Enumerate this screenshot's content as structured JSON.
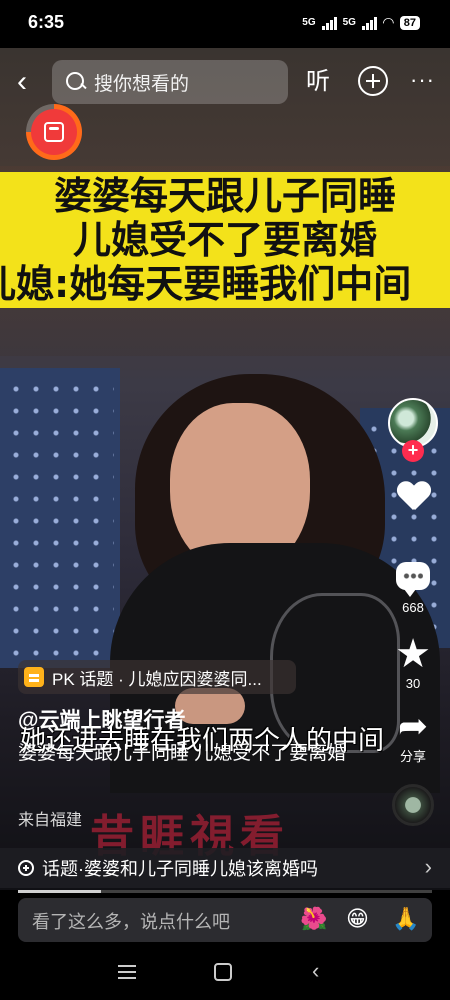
{
  "status_bar": {
    "time": "6:35",
    "network1": "5G",
    "network2": "5G",
    "battery": "87"
  },
  "top_nav": {
    "search_placeholder": "搜你想看的",
    "listen_label": "听"
  },
  "video": {
    "banner_lines": [
      "婆婆每天跟儿子同睡",
      "儿媳受不了要离婚",
      "儿媳:她每天要睡我们中间"
    ],
    "subtitle": "她还进去睡在我们两个人的中间",
    "watermark": "昔睚視看"
  },
  "rail": {
    "comment_count": "668",
    "favorite_count": "30",
    "share_label": "分享"
  },
  "post": {
    "topic_chip": "PK 话题 · 儿媳应因婆婆同...",
    "author": "@云端上眺望行者",
    "description": "婆婆每天跟儿子同睡 儿媳受不了要离婚",
    "location": "来自福建"
  },
  "topic_bar": {
    "label": "话题·婆婆和儿子同睡儿媳该离婚吗"
  },
  "progress_fraction": 0.2,
  "comment_bar": {
    "placeholder": "看了这么多，说点什么吧",
    "emojis": [
      "🌺",
      "😁",
      "🙏"
    ]
  },
  "colors": {
    "banner": "#f3e21a",
    "accent_red": "#ff2c4f",
    "watermark": "#961e32"
  }
}
